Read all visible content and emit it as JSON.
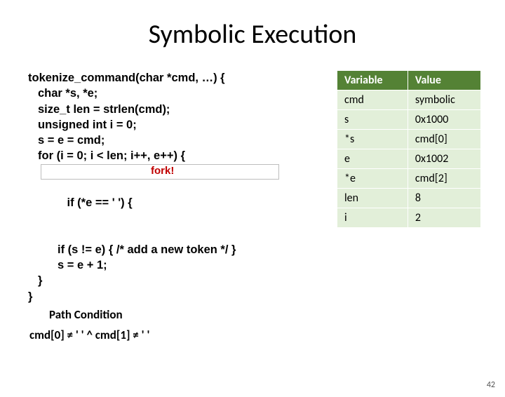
{
  "title": "Symbolic Execution",
  "code": {
    "l0": "tokenize_command(char *cmd, …) {",
    "l1": "char *s, *e;",
    "l2": "size_t len = strlen(cmd);",
    "l3": "unsigned int i = 0;",
    "l4": "s = e = cmd;",
    "l5": "for (i = 0; i < len; i++, e++) {",
    "l6": "if (*e == ' ') {",
    "l6_annot": "fork!",
    "l7": "if (s != e) { /* add a new token */ }",
    "l8": "s = e + 1;",
    "l9": "}",
    "l10": "}"
  },
  "table": {
    "h1": "Variable",
    "h2": "Value",
    "rows": [
      {
        "var": "cmd",
        "val": "symbolic"
      },
      {
        "var": "s",
        "val": "0x1000"
      },
      {
        "var": "*s",
        "val": "cmd[0]"
      },
      {
        "var": "e",
        "val": "0x1002"
      },
      {
        "var": "*e",
        "val": "cmd[2]"
      },
      {
        "var": "len",
        "val": "8"
      },
      {
        "var": "i",
        "val": "2"
      }
    ]
  },
  "path_condition": {
    "label": "Path Condition",
    "text": "cmd[0] ≠ ' ' ^ cmd[1] ≠ ' '"
  },
  "page_number": "42"
}
